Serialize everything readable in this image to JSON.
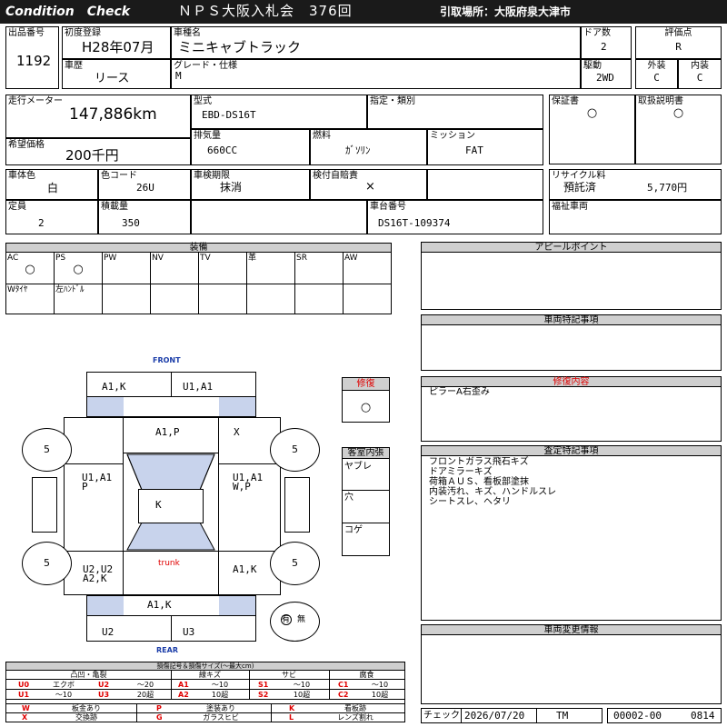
{
  "header": {
    "brand": "Condition　Check",
    "auction": "ＮＰＳ大阪入札会　376回",
    "pickup": "引取場所：大阪府泉大津市"
  },
  "listing": {
    "lot_label": "出品番号",
    "lot": "1192",
    "first_reg_label": "初度登録",
    "first_reg": "H28年07月",
    "history_label": "車歴",
    "history": "リース",
    "name_label": "車種名",
    "name": "ミニキャブトラック",
    "grade_label": "グレード・仕様",
    "grade": "M",
    "doors_label": "ドア数",
    "doors": "2",
    "drive_label": "駆動",
    "drive": "2WD",
    "score_label": "評価点",
    "score": "R",
    "ext_label": "外装",
    "ext": "C",
    "int_label": "内装",
    "int": "C"
  },
  "specs": {
    "mileage_label": "走行メーター",
    "mileage": "147,886km",
    "price_label": "希望価格",
    "price": "200千円",
    "model_label": "型式",
    "model": "EBD-DS16T",
    "designation_label": "指定・類別",
    "designation": "",
    "warranty_label": "保証書",
    "warranty": "○",
    "manual_label": "取扱説明書",
    "manual": "○",
    "displacement_label": "排気量",
    "displacement": "660CC",
    "fuel_label": "燃料",
    "fuel": "ｶﾞｿﾘﾝ",
    "transmission_label": "ミッション",
    "transmission": "FAT",
    "color_label": "車体色",
    "color": "白",
    "color_code_label": "色コード",
    "color_code": "26U",
    "inspection_label": "車検期限",
    "inspection": "抹消",
    "insurance_label": "検付自賠責",
    "insurance": "×",
    "recycle_label": "リサイクル料",
    "recycle_status": "預託済",
    "recycle_fee": "5,770円",
    "capacity_label": "定員",
    "capacity": "2",
    "load_label": "積載量",
    "load": "350",
    "chassis_label": "車台番号",
    "chassis": "DS16T-109374",
    "welfare_label": "福祉車両",
    "welfare": ""
  },
  "equipment": {
    "title": "装備",
    "items": [
      {
        "label": "AC",
        "mark": "○"
      },
      {
        "label": "PS",
        "mark": "○"
      },
      {
        "label": "PW",
        "mark": ""
      },
      {
        "label": "NV",
        "mark": ""
      },
      {
        "label": "TV",
        "mark": ""
      },
      {
        "label": "革",
        "mark": ""
      },
      {
        "label": "SR",
        "mark": ""
      },
      {
        "label": "AW",
        "mark": ""
      },
      {
        "label": "Wﾀｲﾔ",
        "mark": ""
      },
      {
        "label": "左ﾊﾝﾄﾞﾙ",
        "mark": ""
      }
    ]
  },
  "diagram": {
    "front_label": "FRONT",
    "rear_label": "REAR",
    "trunk_label": "trunk",
    "tires": {
      "front_left": "5",
      "front_right": "5",
      "rear_left": "5",
      "rear_right": "5"
    },
    "marks": {
      "front_bumper_left": "A1,K",
      "front_bumper_right": "U1,A1",
      "hood": "A1,P",
      "right_front_fender": "X",
      "left_doors_1": "U1,A1",
      "left_doors_2": "P",
      "right_doors_1": "U1,A1",
      "right_doors_2": "W,P",
      "roof": "K",
      "left_rear_1": "U2,U2",
      "left_rear_2": "A2,K",
      "right_rear": "A1,K",
      "rear_panel": "A1,K",
      "rear_bumper_left": "U2",
      "rear_bumper_right": "U3"
    },
    "spare_present": "有",
    "spare_absent": "無"
  },
  "repair": {
    "title": "修復",
    "mark": "○"
  },
  "interior": {
    "title": "客室内張",
    "rows": [
      "ヤブレ",
      "穴",
      "コゲ"
    ]
  },
  "appeal": {
    "title": "アピールポイント",
    "text": ""
  },
  "special": {
    "title": "車両特記事項",
    "text": ""
  },
  "repair_detail": {
    "title": "修復内容",
    "text": "ピラーA右歪み"
  },
  "inspection_notes": {
    "title": "査定特記事項",
    "lines": [
      "フロントガラス飛石キズ",
      "ドアミラーキズ",
      "荷箱ＡＵＳ、看板部塗抹",
      "内装汚れ、キズ、ハンドルスレ",
      "シートスレ、ヘタリ"
    ]
  },
  "changes": {
    "title": "車両変更情報",
    "text": ""
  },
  "legend": {
    "title": "損傷記号＆損傷サイズ(～最大cm)",
    "groups": [
      {
        "name": "凸凹・亀裂",
        "rows": [
          {
            "c1": "U0",
            "d1": "エクボ",
            "c2": "U2",
            "d2": "～20"
          },
          {
            "c1": "U1",
            "d1": "～10",
            "c2": "U3",
            "d2": "20超"
          }
        ]
      },
      {
        "name": "線キズ",
        "rows": [
          {
            "c1": "A1",
            "d1": "～10"
          },
          {
            "c1": "A2",
            "d1": "10超"
          }
        ]
      },
      {
        "name": "サビ",
        "rows": [
          {
            "c1": "S1",
            "d1": "～10"
          },
          {
            "c1": "S2",
            "d1": "10超"
          }
        ]
      },
      {
        "name": "腐食",
        "rows": [
          {
            "c1": "C1",
            "d1": "～10"
          },
          {
            "c1": "C2",
            "d1": "10超"
          }
        ]
      }
    ],
    "codes": [
      {
        "c": "W",
        "d": "板金あり"
      },
      {
        "c": "P",
        "d": "塗装あり"
      },
      {
        "c": "K",
        "d": "看板跡"
      },
      {
        "c": "X",
        "d": "交換跡"
      },
      {
        "c": "G",
        "d": "ガラスヒビ"
      },
      {
        "c": "L",
        "d": "レンズ割れ"
      }
    ]
  },
  "footer": {
    "check_label": "チェック",
    "date": "2026/07/20",
    "inspector": "TM",
    "code": "00002-00",
    "number": "0814"
  },
  "colors": {
    "header_bg": "#1a1a1a",
    "red": "#e00000",
    "blue": "#1a3ca8",
    "shade": "#c8d3ec",
    "gray": "#cfcfcf"
  }
}
